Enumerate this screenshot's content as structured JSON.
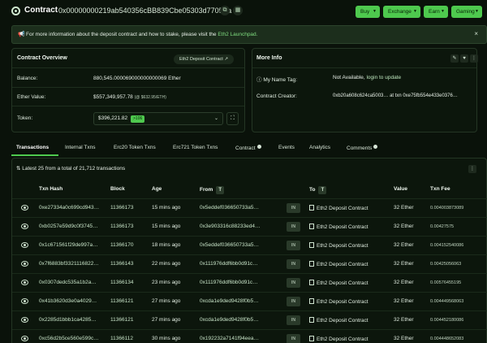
{
  "header": {
    "title": "Contract",
    "address": "0x00000000219ab540356cBB839Cbe05303d7705Fa",
    "copy_icon": "copy-icon",
    "qr_icon": "qr-icon",
    "menu": [
      {
        "label": "Buy"
      },
      {
        "label": "Exchange"
      },
      {
        "label": "Earn"
      },
      {
        "label": "Gaming"
      }
    ]
  },
  "banner": {
    "text": "For more information about the deposit contract and how to stake, please visit the",
    "link": "Eth2 Launchpad.",
    "close": "×"
  },
  "overview": {
    "title": "Contract Overview",
    "badge": "Eth2 Deposit Contract",
    "balance_label": "Balance:",
    "balance_value": "880,545.000069000000000069 Ether",
    "ether_value_label": "Ether Value:",
    "ether_value": "$557,349,957.78",
    "ether_rate": "(@ $632.95/ETH)",
    "token_label": "Token:",
    "token_value": "$396,221.82",
    "token_badge": ">106"
  },
  "more_info": {
    "title": "More Info",
    "name_tag_label": "My Name Tag:",
    "name_tag_value": "Not Available,",
    "name_tag_link": "login to update",
    "creator_label": "Contract Creator:",
    "creator_value": "0xb20a608c624ca5003…",
    "creator_at": "at txn",
    "creator_txn": "0xe75fb554e433e0376…"
  },
  "tabs": [
    {
      "label": "Transactions"
    },
    {
      "label": "Internal Txns"
    },
    {
      "label": "Erc20 Token Txns"
    },
    {
      "label": "Erc721 Token Txns"
    },
    {
      "label": "Contract"
    },
    {
      "label": "Events"
    },
    {
      "label": "Analytics"
    },
    {
      "label": "Comments"
    }
  ],
  "transactions": {
    "summary": "Latest 25 from a total of 21,712 transactions",
    "columns": [
      "Txn Hash",
      "Block",
      "Age",
      "From",
      "To",
      "Value",
      "Txn Fee"
    ],
    "rows": [
      {
        "hash": "0xe27334a0c699cd943…",
        "block": "11366173",
        "age": "15 mins ago",
        "from": "0x5eddef036650733a5…",
        "to": "Eth2 Deposit Contract",
        "value": "32 Ether",
        "fee": "0.004003873089"
      },
      {
        "hash": "0xb0257e59d9c0f3745…",
        "block": "11366173",
        "age": "15 mins ago",
        "from": "0x3e903316c88233ed4…",
        "to": "Eth2 Deposit Contract",
        "value": "32 Ether",
        "fee": "0.00427575"
      },
      {
        "hash": "0x1c671561f29de997a…",
        "block": "11366170",
        "age": "18 mins ago",
        "from": "0x5eddef036650733a5…",
        "to": "Eth2 Deposit Contract",
        "value": "32 Ether",
        "fee": "0.004152540086"
      },
      {
        "hash": "0x7f6883bf3321116822…",
        "block": "11366143",
        "age": "22 mins ago",
        "from": "0x111976ddf6bb0d91c…",
        "to": "Eth2 Deposit Contract",
        "value": "32 Ether",
        "fee": "0.00425056063"
      },
      {
        "hash": "0x0307dedc535a1b2a…",
        "block": "11366134",
        "age": "23 mins ago",
        "from": "0x111976ddf6bb0d91c…",
        "to": "Eth2 Deposit Contract",
        "value": "32 Ether",
        "fee": "0.00576455195"
      },
      {
        "hash": "0x41b3620d3e0a4029…",
        "block": "11366121",
        "age": "27 mins ago",
        "from": "0xcda1e9ded9428f0b5…",
        "to": "Eth2 Deposit Contract",
        "value": "32 Ether",
        "fee": "0.004449568063"
      },
      {
        "hash": "0x2285d1bbb1ca4285…",
        "block": "11366121",
        "age": "27 mins ago",
        "from": "0xcda1e9ded9428f0b5…",
        "to": "Eth2 Deposit Contract",
        "value": "32 Ether",
        "fee": "0.004452180086"
      },
      {
        "hash": "0xc56d2b5ce560e599c…",
        "block": "11366112",
        "age": "30 mins ago",
        "from": "0x192232a7141f94eea…",
        "to": "Eth2 Deposit Contract",
        "value": "32 Ether",
        "fee": "0.004448652083"
      }
    ]
  },
  "colors": {
    "accent": "#4ec94e",
    "background": "#0a120a",
    "panel": "#0c160c"
  }
}
